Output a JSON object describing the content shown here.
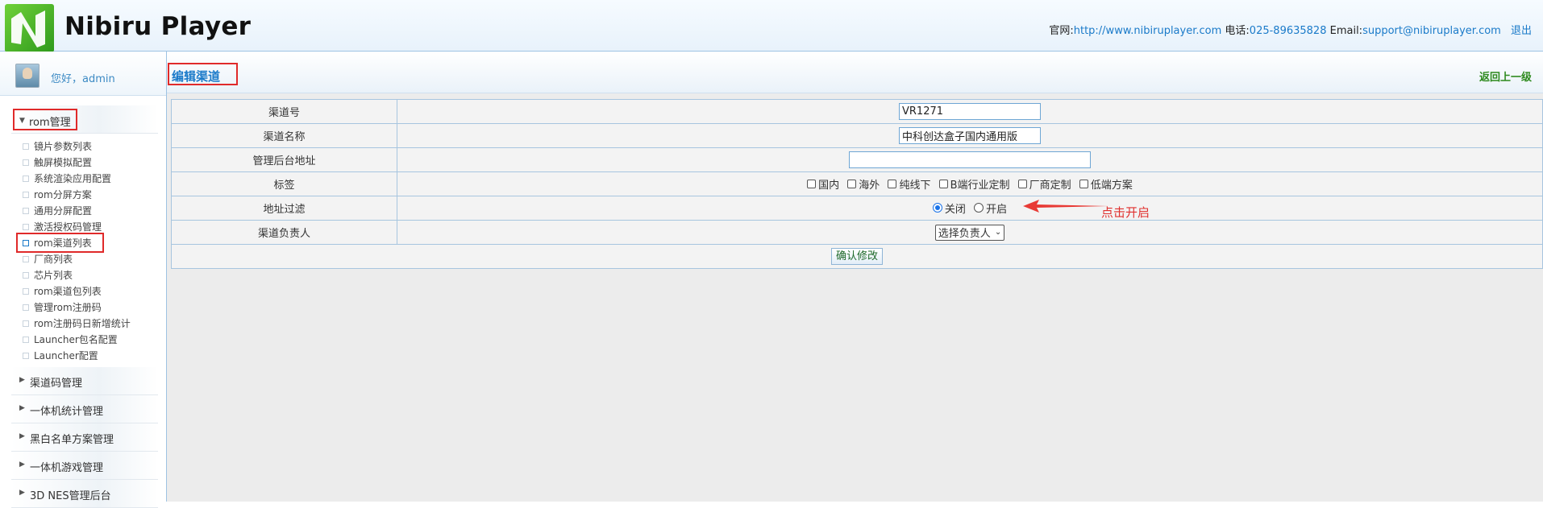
{
  "header": {
    "app_title": "Nibiru Player",
    "website_label": "官网:",
    "website_url": "http://www.nibiruplayer.com",
    "phone_label": "电话:",
    "phone": "025-89635828",
    "email_label": "Email:",
    "email": "support@nibiruplayer.com",
    "logout": "退出"
  },
  "sidebar": {
    "greeting": "您好，admin",
    "open_group": {
      "label": "rom管理",
      "items": [
        {
          "label": "镜片参数列表"
        },
        {
          "label": "触屏模拟配置"
        },
        {
          "label": "系统渲染应用配置"
        },
        {
          "label": "rom分屏方案"
        },
        {
          "label": "通用分屏配置"
        },
        {
          "label": "激活授权码管理"
        },
        {
          "label": "rom渠道列表"
        },
        {
          "label": "厂商列表"
        },
        {
          "label": "芯片列表"
        },
        {
          "label": "rom渠道包列表"
        },
        {
          "label": "管理rom注册码"
        },
        {
          "label": "rom注册码日新增统计"
        },
        {
          "label": "Launcher包名配置"
        },
        {
          "label": "Launcher配置"
        }
      ]
    },
    "closed_groups": [
      {
        "label": "渠道码管理"
      },
      {
        "label": "一体机统计管理"
      },
      {
        "label": "黑白名单方案管理"
      },
      {
        "label": "一体机游戏管理"
      },
      {
        "label": "3D NES管理后台"
      }
    ]
  },
  "main": {
    "page_title": "编辑渠道",
    "back_link": "返回上一级",
    "form": {
      "channel_no_label": "渠道号",
      "channel_no_value": "VR1271",
      "channel_name_label": "渠道名称",
      "channel_name_value": "中科创达盒子国内通用版",
      "admin_url_label": "管理后台地址",
      "admin_url_value": "",
      "tags_label": "标签",
      "tags": [
        "国内",
        "海外",
        "纯线下",
        "B端行业定制",
        "厂商定制",
        "低端方案"
      ],
      "filter_label": "地址过滤",
      "filter_off": "关闭",
      "filter_on": "开启",
      "owner_label": "渠道负责人",
      "owner_select": "选择负责人",
      "submit": "确认修改"
    },
    "annotation": "点击开启"
  }
}
